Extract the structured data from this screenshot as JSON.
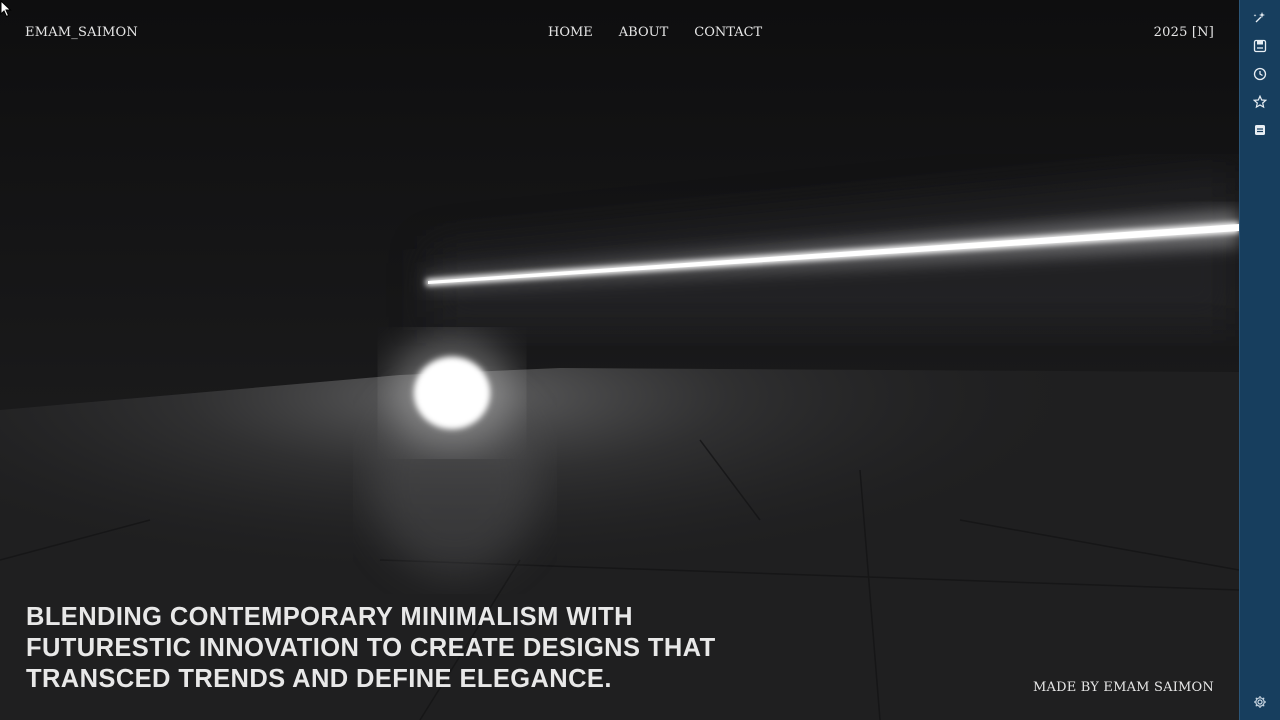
{
  "header": {
    "brand": "EMAM_SAIMON",
    "nav": [
      {
        "label": "HOME"
      },
      {
        "label": "ABOUT"
      },
      {
        "label": "CONTACT"
      }
    ],
    "year_badge": "2025 [N]"
  },
  "hero": {
    "headline_lines": [
      "BLENDING CONTEMPORARY MINIMALISM WITH",
      "FUTURESTIC INNOVATION TO CREATE DESIGNS THAT",
      "TRANSCED TRENDS AND DEFINE ELEGANCE."
    ]
  },
  "footer": {
    "credit": "MADE BY EMAM SAIMON"
  },
  "sidebar": {
    "icons": [
      "sparkle-pin-icon",
      "save-page-icon",
      "history-icon",
      "star-icon",
      "reader-icon",
      "settings-icon"
    ]
  },
  "colors": {
    "sidebar_bg": "#173e5e",
    "scene_bg": "#131314",
    "text": "#e6e6e6"
  }
}
